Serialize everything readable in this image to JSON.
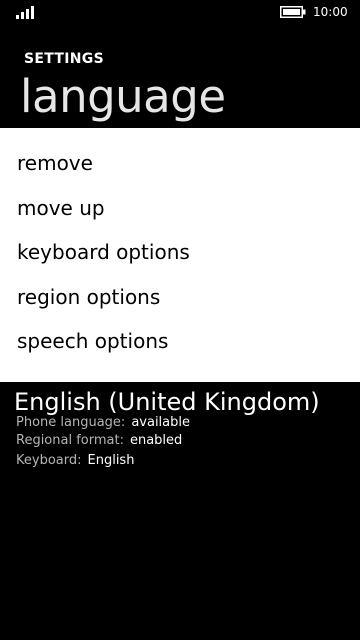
{
  "status_bar": {
    "time": "10:00",
    "signal_icon": "signal-bars-icon",
    "battery_icon": "battery-icon"
  },
  "header": {
    "app_title": "SETTINGS",
    "page_title": "language"
  },
  "context_menu": {
    "items": [
      {
        "label": "remove"
      },
      {
        "label": "move up"
      },
      {
        "label": "keyboard options"
      },
      {
        "label": "region options"
      },
      {
        "label": "speech options"
      }
    ]
  },
  "language_item": {
    "name": "English (United Kingdom)",
    "details": [
      {
        "label": "Phone language:",
        "value": "available"
      },
      {
        "label": "Regional format:",
        "value": "enabled"
      },
      {
        "label": "Keyboard:",
        "value": "English"
      }
    ]
  },
  "colors": {
    "background": "#000000",
    "menu_background": "#ffffff",
    "menu_text": "#000000",
    "secondary_text": "#b4b4b4"
  }
}
